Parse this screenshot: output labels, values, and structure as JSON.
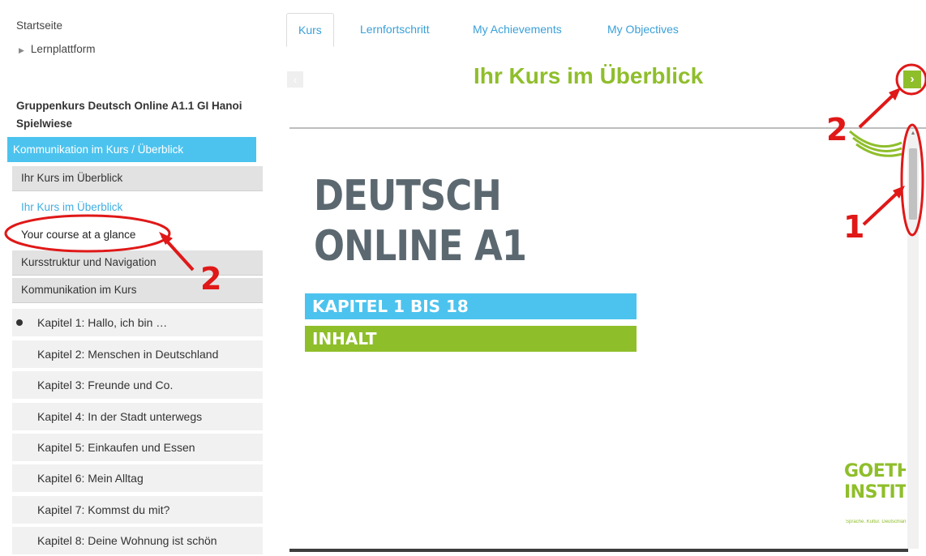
{
  "breadcrumb": {
    "home": "Startseite",
    "sub": "Lernplattform"
  },
  "course": {
    "title": "Gruppenkurs Deutsch Online A1.1 GI Hanoi Spielwiese"
  },
  "sidebar": {
    "section_active": "Kommunikation im Kurs / Überblick",
    "items": [
      {
        "label": "Ihr Kurs im Überblick"
      },
      {
        "label": "Ihr Kurs im Überblick"
      },
      {
        "label": "Your course at a glance"
      },
      {
        "label": "Kursstruktur und Navigation"
      },
      {
        "label": "Kommunikation im Kurs"
      }
    ],
    "chapters": [
      {
        "label": "Kapitel 1: Hallo, ich bin …"
      },
      {
        "label": "Kapitel 2: Menschen in Deutschland"
      },
      {
        "label": "Kapitel 3: Freunde und Co."
      },
      {
        "label": "Kapitel 4: In der Stadt unterwegs"
      },
      {
        "label": "Kapitel 5: Einkaufen und Essen"
      },
      {
        "label": "Kapitel 6: Mein Alltag"
      },
      {
        "label": "Kapitel 7: Kommst du mit?"
      },
      {
        "label": "Kapitel 8: Deine Wohnung ist schön"
      }
    ]
  },
  "tabs": [
    {
      "label": "Kurs"
    },
    {
      "label": "Lernfortschritt"
    },
    {
      "label": "My Achievements"
    },
    {
      "label": "My Objectives"
    }
  ],
  "slide": {
    "heading": "Ihr Kurs im Überblick",
    "prev_symbol": "‹",
    "next_symbol": "›",
    "title_line1": "DEUTSCH",
    "title_line2": "ONLINE A1",
    "band1": "KAPITEL 1 BIS 18",
    "band2": "INHALT",
    "logo_line1": "GOETH",
    "logo_line2": "INSTIT",
    "logo_tagline": "Sprache. Kultur. Deutschland."
  },
  "annotations": [
    "2",
    "2",
    "1"
  ],
  "colors": {
    "accent_blue": "#4cc3ee",
    "accent_green": "#8fbe2b",
    "annotation_red": "#e01818"
  }
}
